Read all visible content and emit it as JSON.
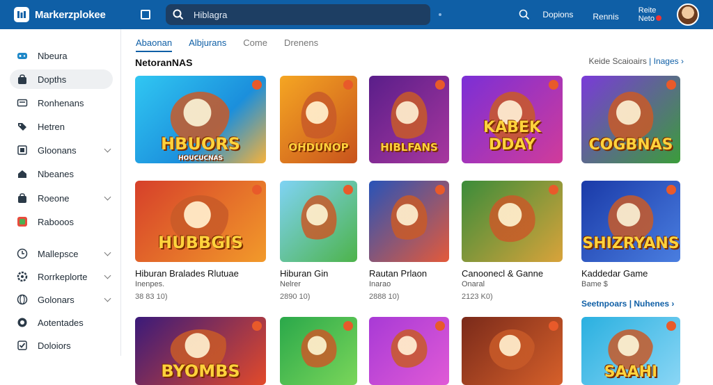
{
  "app": {
    "name": "Markerzplokee"
  },
  "search": {
    "value": "Hiblagra"
  },
  "header": {
    "item1": "Dopions",
    "item2": "Rennis",
    "item3a": "Reite",
    "item3b": "Neto"
  },
  "sidebar": {
    "items": [
      {
        "label": "Nbeura",
        "icon": "gamepad-icon"
      },
      {
        "label": "Dopths",
        "icon": "bag-icon"
      },
      {
        "label": "Ronhenans",
        "icon": "mail-icon"
      },
      {
        "label": "Hetren",
        "icon": "tag-icon"
      },
      {
        "label": "Gloonans",
        "icon": "grid-icon"
      },
      {
        "label": "Nbeanes",
        "icon": "home-icon"
      },
      {
        "label": "Roeone",
        "icon": "bag-icon"
      },
      {
        "label": "Rabooos",
        "icon": "app-icon"
      },
      {
        "label": "Mallepsce",
        "icon": "clock-icon"
      },
      {
        "label": "Rorrkeplorte",
        "icon": "settings-icon"
      },
      {
        "label": "Golonars",
        "icon": "globe-icon"
      },
      {
        "label": "Aotentades",
        "icon": "chat-icon"
      },
      {
        "label": "Doloiors",
        "icon": "check-icon"
      }
    ]
  },
  "tabs": [
    "Abaonan",
    "Albjurans",
    "Come",
    "Drenens"
  ],
  "section": {
    "title": "NetoranNAS",
    "see_all_text": "Keide Scaioairs",
    "see_all_link": "Inages"
  },
  "row1": [
    {
      "art": "HBUORS",
      "art2": "HOUCUCNAS"
    },
    {
      "art": "OHDUNOP"
    },
    {
      "art": "HIBLFANS"
    },
    {
      "art": "KABEK DDAY"
    },
    {
      "art": "COGBNAS"
    }
  ],
  "row2": [
    {
      "art": "HUBBGIS",
      "title": "Hiburan Bralades Rlutuae",
      "sub": "Inenpes.",
      "meta": "38 83 10)"
    },
    {
      "art": "",
      "title": "Hiburan  Gin",
      "sub": "Nelrer",
      "meta": "2890 10)"
    },
    {
      "art": "",
      "title": "Rautan Prlaon",
      "sub": "Inarao",
      "meta": "2888 10)"
    },
    {
      "art": "",
      "title": "Canoonecl & Ganne",
      "sub": "Onaral",
      "meta": "2123 K0)"
    },
    {
      "art": "SHIZRYANS",
      "title": "Kaddedar Game",
      "sub": "Bame $"
    }
  ],
  "row2_link": {
    "text": "Seetnpoars",
    "link": "Nuhenes"
  },
  "row3": [
    {
      "art": "BYOMBS"
    },
    {
      "art": ""
    },
    {
      "art": ""
    },
    {
      "art": ""
    },
    {
      "art": "SAAHI"
    }
  ],
  "colors": {
    "topbar": "#0f5fa6",
    "accent": "#0f5fa6",
    "search_bg": "#1d3e63"
  }
}
